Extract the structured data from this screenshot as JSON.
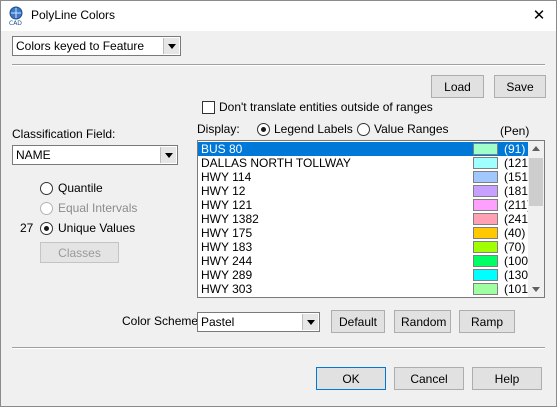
{
  "window": {
    "title": "PolyLine Colors"
  },
  "colors": {
    "accent": "#0078d7"
  },
  "keyed_combo": {
    "value": "Colors keyed to Feature"
  },
  "buttons": {
    "load": "Load",
    "save": "Save",
    "classes": "Classes",
    "default": "Default",
    "random": "Random",
    "ramp": "Ramp",
    "ok": "OK",
    "cancel": "Cancel",
    "help": "Help"
  },
  "translate_checkbox": {
    "label": "Don't translate entities outside of ranges",
    "checked": false
  },
  "classification": {
    "label": "Classification Field:",
    "value": "NAME"
  },
  "method": {
    "quantile": "Quantile",
    "equal_intervals": "Equal Intervals",
    "unique_values": "Unique Values",
    "count": "27"
  },
  "display": {
    "label": "Display:",
    "legend_labels": "Legend Labels",
    "value_ranges": "Value Ranges",
    "pen_header": "(Pen)"
  },
  "rows": [
    {
      "name": "BUS 80",
      "pen": "(91)",
      "color": "#a0ffc8",
      "selected": true
    },
    {
      "name": "DALLAS NORTH TOLLWAY",
      "pen": "(121)",
      "color": "#a0ffff",
      "selected": false
    },
    {
      "name": "HWY 114",
      "pen": "(151)",
      "color": "#a0c8ff",
      "selected": false
    },
    {
      "name": "HWY 12",
      "pen": "(181)",
      "color": "#c8a0ff",
      "selected": false
    },
    {
      "name": "HWY 121",
      "pen": "(211)",
      "color": "#ffa0ff",
      "selected": false
    },
    {
      "name": "HWY 1382",
      "pen": "(241)",
      "color": "#ffa0b4",
      "selected": false
    },
    {
      "name": "HWY 175",
      "pen": "(40)",
      "color": "#ffc800",
      "selected": false
    },
    {
      "name": "HWY 183",
      "pen": "(70)",
      "color": "#a0ff00",
      "selected": false
    },
    {
      "name": "HWY 244",
      "pen": "(100)",
      "color": "#00ff64",
      "selected": false
    },
    {
      "name": "HWY 289",
      "pen": "(130)",
      "color": "#00ffff",
      "selected": false
    },
    {
      "name": "HWY 303",
      "pen": "(101)",
      "color": "#a0ffa0",
      "selected": false
    }
  ],
  "color_scheme": {
    "label": "Color Scheme:",
    "value": "Pastel"
  },
  "icons": {
    "app": "cad-app-icon",
    "close": "close-icon",
    "dropdown": "chevron-down-icon"
  }
}
